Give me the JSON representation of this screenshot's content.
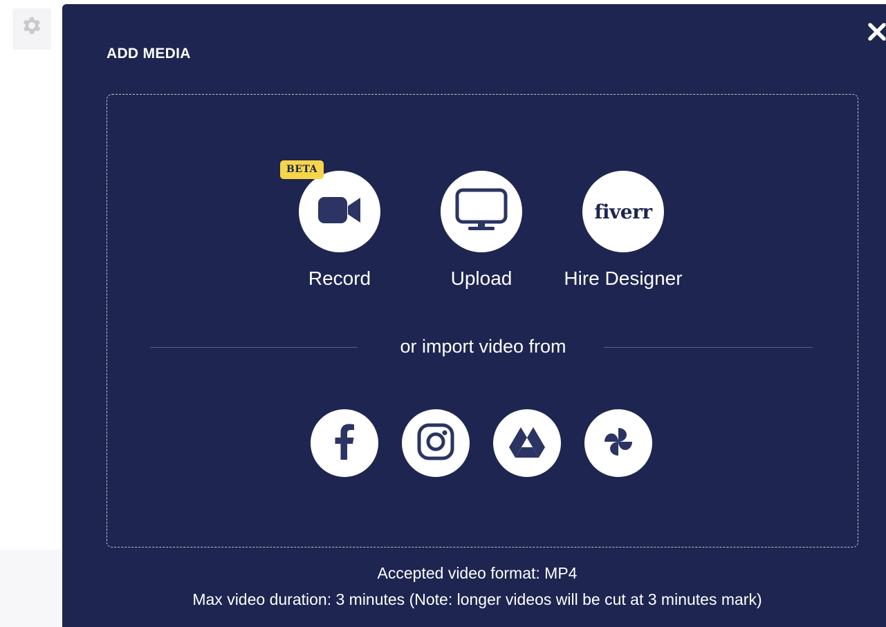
{
  "modal": {
    "title": "ADD MEDIA",
    "close_icon": "close-icon"
  },
  "options": [
    {
      "label": "Record",
      "icon": "video-camera-icon",
      "badge": "BETA"
    },
    {
      "label": "Upload",
      "icon": "monitor-icon"
    },
    {
      "label": "Hire Designer",
      "icon": "fiverr-logo",
      "logo_text": "fiverr"
    }
  ],
  "import": {
    "label": "or import video from",
    "sources": [
      {
        "name": "Facebook",
        "icon": "facebook-icon"
      },
      {
        "name": "Instagram",
        "icon": "instagram-icon"
      },
      {
        "name": "Google Drive",
        "icon": "google-drive-icon"
      },
      {
        "name": "Google Photos",
        "icon": "google-photos-icon"
      }
    ]
  },
  "footer": {
    "format": "Accepted video format: MP4",
    "duration": "Max video duration: 3 minutes (Note: longer videos will be cut at 3 minutes mark)"
  },
  "colors": {
    "modal_bg": "#1d2550",
    "icon_fill": "#2b3462",
    "badge_bg": "#f6d548",
    "text": "#ffffff"
  }
}
